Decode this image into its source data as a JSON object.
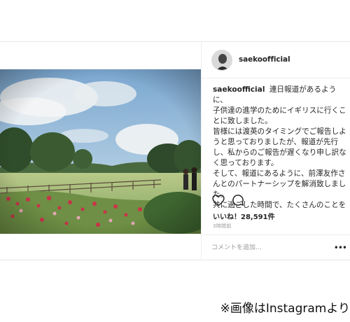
{
  "post": {
    "username": "saekoofficial",
    "caption_lines": [
      "連日報道があるように、",
      "子供達の進学のためにイギリスに行くことに致しました。",
      "皆様には渡英のタイミングでご報告しようと思っておりましたが、報道が先行し、私からのご報告が遅くなり申し訳なく思っております。",
      "そして、報道にあるように、前澤友作さんとのパートナーシップを解消致しました。",
      "共に過ごした時間で、たくさんのことを"
    ],
    "likes_text": "いいね！28,591件",
    "timestamp": "3時間前",
    "comment_placeholder": "コメントを追加...",
    "more_label": "•••"
  },
  "icons": {
    "like": "heart-icon",
    "comment": "comment-icon"
  },
  "credit": "※画像はInstagramより"
}
